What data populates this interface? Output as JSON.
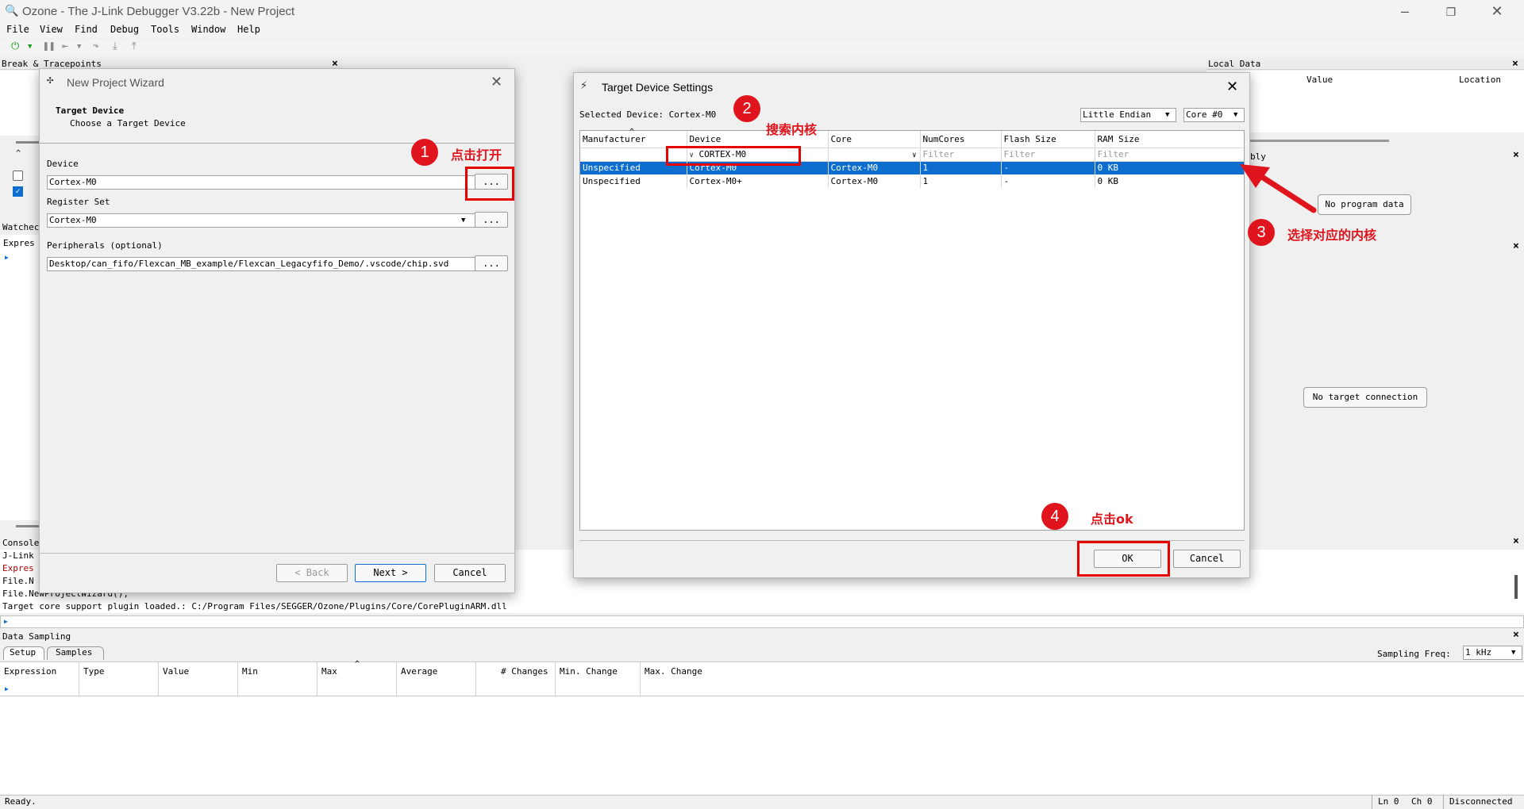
{
  "window": {
    "title": "Ozone - The J-Link Debugger V3.22b - New Project"
  },
  "menu": [
    "File",
    "View",
    "Find",
    "Debug",
    "Tools",
    "Window",
    "Help"
  ],
  "panels": {
    "breakpoints": "Break & Tracepoints",
    "local_data": {
      "title": "Local Data",
      "col_value": "Value",
      "col_location": "Location"
    },
    "disassembly_partial": "bly",
    "no_program_data": "No program data",
    "no_target_connection": "No target connection",
    "watched_partial": "Watchec",
    "expression_partial": "Expres",
    "console": {
      "title": "Console",
      "lines": [
        "J-Link",
        "Expres",
        "File.N",
        "File.NewProjectWizard();",
        "Target core support plugin loaded.: C:/Program Files/SEGGER/Ozone/Plugins/Core/CorePluginARM.dll"
      ]
    },
    "data_sampling": {
      "title": "Data Sampling",
      "tabs": [
        "Setup",
        "Samples"
      ],
      "freq_label": "Sampling Freq:",
      "freq_value": "1 kHz",
      "columns": [
        "Expression",
        "Type",
        "Value",
        "Min",
        "Max",
        "Average",
        "# Changes",
        "Min. Change",
        "Max. Change"
      ]
    }
  },
  "status": {
    "left": "Ready.",
    "ln": "Ln 0",
    "ch": "Ch 0",
    "conn": "Disconnected"
  },
  "wizard": {
    "title": "New Project Wizard",
    "heading": "Target Device",
    "subheading": "Choose a Target Device",
    "device_label": "Device",
    "device_value": "Cortex-M0",
    "regset_label": "Register Set",
    "regset_value": "Cortex-M0",
    "periph_label": "Peripherals (optional)",
    "periph_value": "Desktop/can_fifo/Flexcan_MB_example/Flexcan_Legacyfifo_Demo/.vscode/chip.svd",
    "browse": "...",
    "back": "< Back",
    "next": "Next >",
    "cancel": "Cancel"
  },
  "tds": {
    "title": "Target Device Settings",
    "selected_label": "Selected Device: Cortex-M0",
    "endian": "Little Endian",
    "core": "Core #0",
    "columns": [
      "Manufacturer",
      "Device",
      "Core",
      "NumCores",
      "Flash Size",
      "RAM Size"
    ],
    "filter_device": "CORTEX-M0",
    "filter_placeholder": "Filter",
    "rows": [
      [
        "Unspecified",
        "Cortex-M0",
        "Cortex-M0",
        "1",
        "-",
        "0 KB"
      ],
      [
        "Unspecified",
        "Cortex-M0+",
        "Cortex-M0",
        "1",
        "-",
        "0 KB"
      ]
    ],
    "ok": "OK",
    "cancel": "Cancel"
  },
  "annotations": {
    "n1": "1",
    "t1": "点击打开",
    "n2": "2",
    "t2": "搜索内核",
    "n3": "3",
    "t3": "选择对应的内核",
    "n4": "4",
    "t4": "点击ok"
  },
  "colors": {
    "accent": "#0e6ed0",
    "annotation": "#e0141c"
  }
}
